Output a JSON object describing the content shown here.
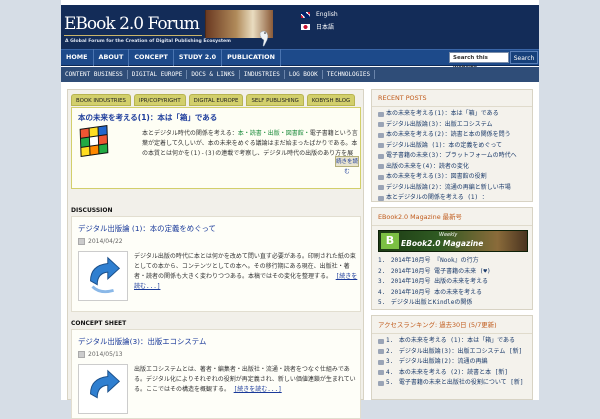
{
  "header": {
    "site_title": "EBook 2.0 Forum",
    "tagline": "A Global Forum for the Creation of Digital Publishing Ecosystem",
    "languages": [
      {
        "label": "English",
        "flag_icon": "uk-flag-icon"
      },
      {
        "label": "日本語",
        "flag_icon": "japan-flag-icon"
      }
    ]
  },
  "nav": {
    "items": [
      "HOME",
      "ABOUT",
      "CONCEPT",
      "STUDY 2.0",
      "PUBLICATION"
    ],
    "search_placeholder": "Search this website",
    "search_button": "Search"
  },
  "subnav": {
    "items": [
      "CONTENT BUSINESS",
      "DIGITAL EUROPE",
      "DOCS & LINKS",
      "INDUSTRIES",
      "LOG BOOK",
      "TECHNOLOGIES"
    ]
  },
  "tabs": [
    "BOOK INDUSTRIES",
    "IPR/COPYRIGHT",
    "DIGITAL EUROPE",
    "SELF PUBLISHING",
    "KOBYSH BLOG"
  ],
  "feature": {
    "title": "本の未来を考える(1)：本は「箱」である",
    "text_lead": "本とデジタル時代の関係を考える：",
    "text_highlight": "本・読書・出版・図書館・",
    "text_rest": "電子書籍という言葉が定着して久しいが、本の未来をめぐる議論はまだ始まったばかりである。本の本質とは何かを(1)-(3)の連載で考察し、デジタル時代の出版のあり方を展望する。本を「箱」として捉え直すことで新しい視点が見えてくる。",
    "more_label": "続きを読む"
  },
  "sections": [
    {
      "label": "DISCUSSION",
      "title": "デジタル出版論 (1)：本の定義をめぐって",
      "date": "2014/04/22",
      "text": "デジタル出版の時代に本とは何かを改めて問い直す必要がある。印刷された紙の束としての本から、コンテンツとしての本へ。その移行期にある現在、出版社・著者・読者の関係も大きく変わりつつある。本稿ではその変化を整理する。",
      "more": "[続きを読む...]"
    },
    {
      "label": "CONCEPT SHEET",
      "title": "デジタル出版論(3)：出版エコシステム",
      "date": "2014/05/13",
      "text": "出版エコシステムとは、著者・編集者・出版社・流通・読者をつなぐ仕組みである。デジタル化によりそれぞれの役割が再定義され、新しい価値連鎖が生まれている。ここではその構造を概観する。",
      "more": "[続きを読む...]"
    }
  ],
  "sidebar": {
    "recent_title": "RECENT POSTS",
    "recent_posts": [
      "本の未来を考える(1)：本は「箱」である",
      "デジタル出版論(3)：出版エコシステム",
      "本の未来を考える(2)：読書と本の関係を問う",
      "デジタル出版論 (1)：本の定義をめぐって",
      "電子書籍の未来(3)：プラットフォームの時代へ",
      "出版の未来を(4)：読者の変化",
      "本の未来を考える(3)：図書館の役割",
      "デジタル出版論(2)：流通の再編と新しい市場",
      "本とデジタルの関係を考える (1) ："
    ],
    "magazine_title": "EBook2.0 Magazine 最新号",
    "magazine_weekly": "Weekly",
    "magazine_name": "EBook2.0 Magazine",
    "magazine_items": [
      "2014年10月号 『Nook』の行方",
      "2014年10月号 電子書籍の未来 (♥)",
      "2014年10月号 出版の未来を考える",
      "2014年10月号 本の未来を考える",
      "デジタル出版とKindleの関係"
    ],
    "ranking_title": "アクセスランキング: 過去30日 (5/7更新)",
    "ranking_items": [
      "本の未来を考える (1)：本は「箱」である",
      "デジタル出版論(3)：出版エコシステム [新]",
      "デジタル出版論(2)：流通の再編",
      "本の未来を考える (2)：読書と本 [新]",
      "電子書籍の未来と出版社の役割について [新]"
    ]
  },
  "colors": {
    "header_bg": "#132c58",
    "nav_bg": "#1d4a8a",
    "tab_bg": "#d2cf6b",
    "link": "#1a3a9a",
    "widget_title": "#c05a1a"
  }
}
